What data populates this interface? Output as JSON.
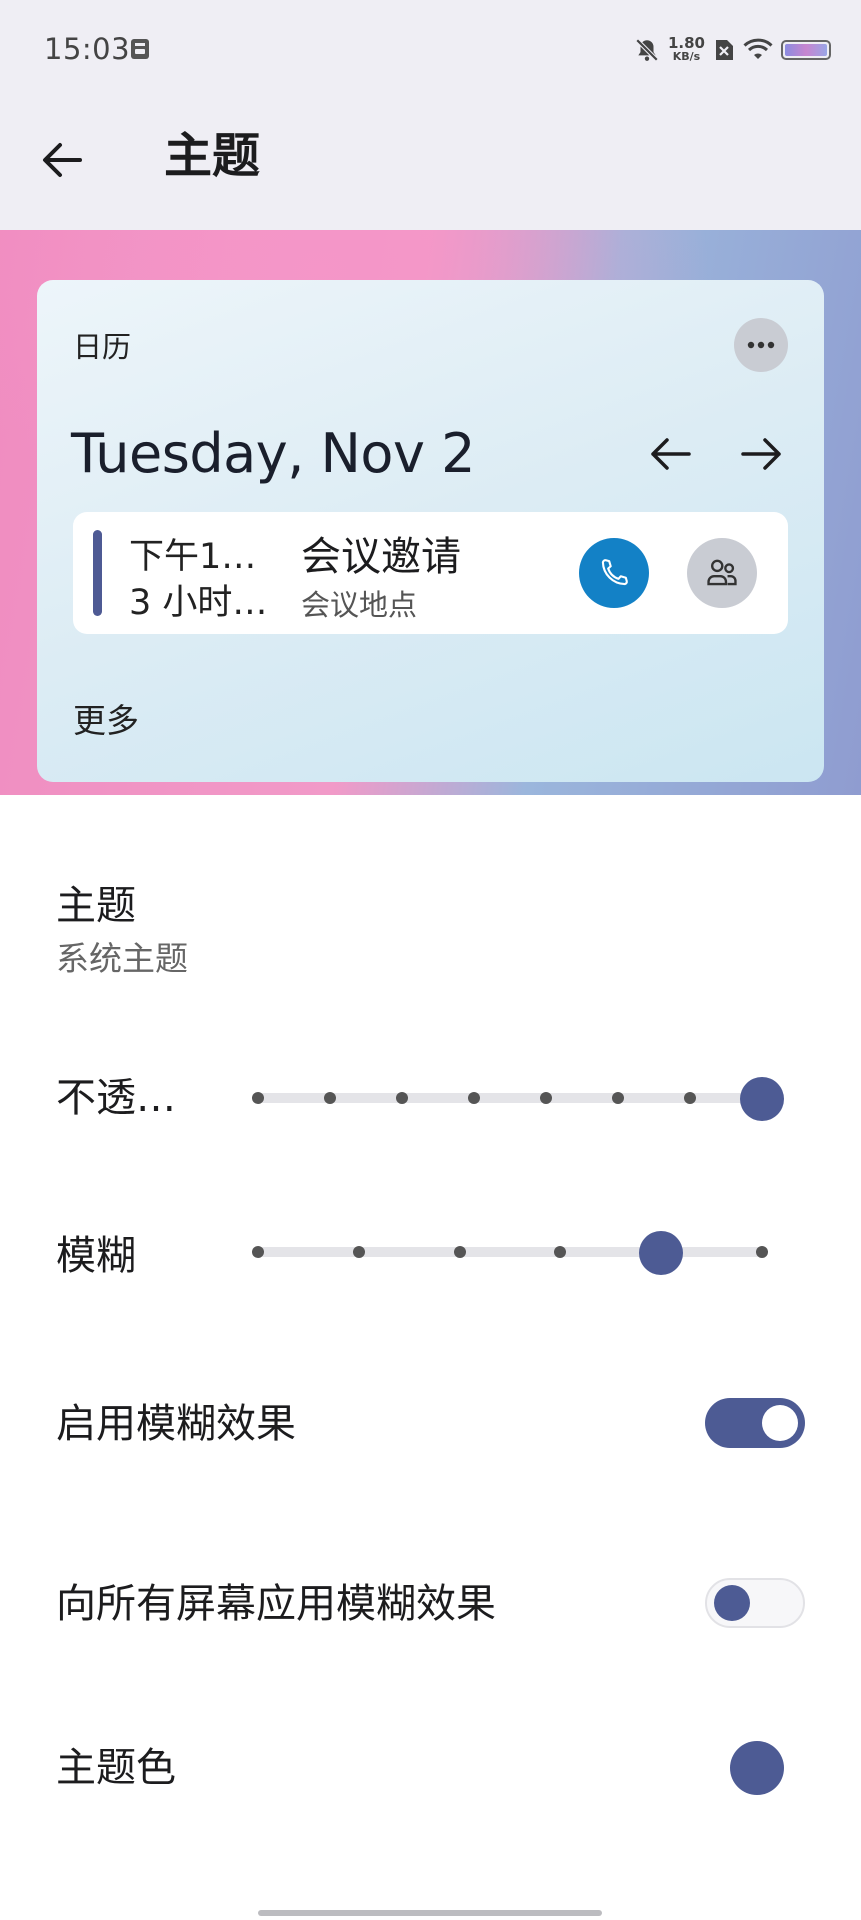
{
  "status_bar": {
    "time": "15:03",
    "net_speed_value": "1.80",
    "net_speed_unit": "KB/s",
    "icons": [
      "sd-card-icon",
      "bell-muted-icon",
      "sim-disabled-icon",
      "wifi-icon",
      "battery-icon"
    ]
  },
  "app_bar": {
    "title": "主题",
    "back_icon": "arrow-left-icon"
  },
  "preview": {
    "widget_title": "日历",
    "date": "Tuesday, Nov 2",
    "event": {
      "time_line1": "下午1…",
      "time_line2": "3 小时…",
      "title": "会议邀请",
      "location": "会议地点"
    },
    "more_link": "更多"
  },
  "settings": {
    "theme": {
      "label": "主题",
      "value": "系统主题"
    },
    "opacity": {
      "label": "不透…",
      "steps": 8,
      "selected_index": 7
    },
    "blur": {
      "label": "模糊",
      "steps": 6,
      "selected_index": 4
    },
    "enable_blur": {
      "label": "启用模糊效果",
      "on": true
    },
    "blur_all_screens": {
      "label": "向所有屏幕应用模糊效果",
      "on": false
    },
    "theme_color": {
      "label": "主题色",
      "color": "#4d5b94"
    }
  },
  "colors": {
    "accent": "#4d5b94",
    "call_button": "#1381c6"
  }
}
